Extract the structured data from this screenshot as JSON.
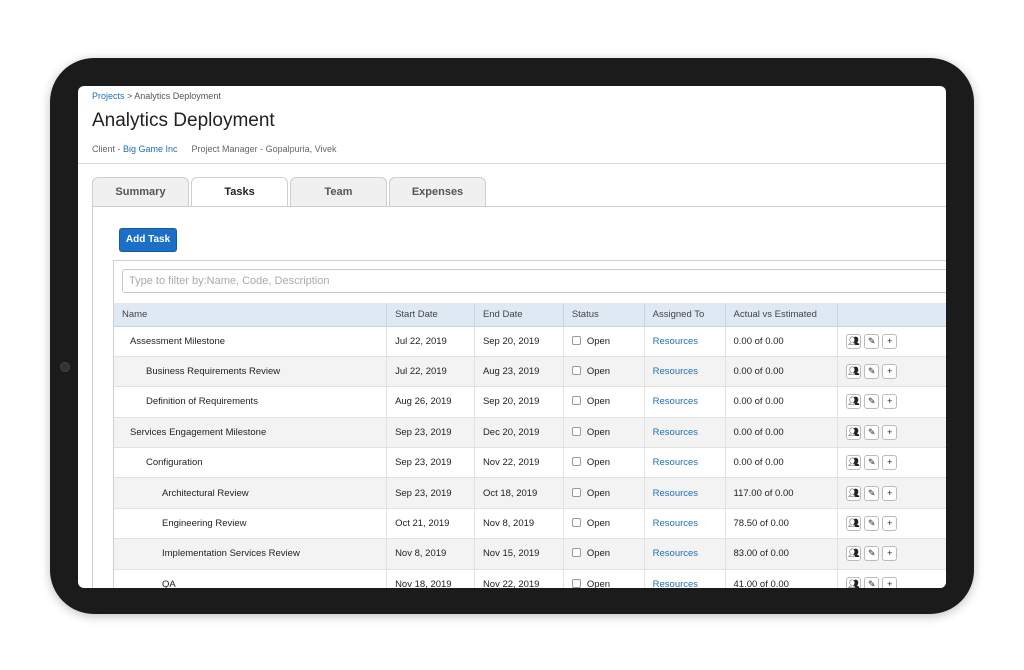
{
  "breadcrumb": {
    "root": "Projects",
    "separator": " > ",
    "current": "Analytics Deployment"
  },
  "page": {
    "title": "Analytics Deployment"
  },
  "meta": {
    "client_label": "Client - ",
    "client_name": "Big Game Inc",
    "pm_label": "Project Manager - ",
    "pm_name": "Gopalpuria, Vivek"
  },
  "tabs": [
    {
      "label": "Summary",
      "active": false
    },
    {
      "label": "Tasks",
      "active": true
    },
    {
      "label": "Team",
      "active": false
    },
    {
      "label": "Expenses",
      "active": false
    }
  ],
  "toolbar": {
    "add_task_label": "Add Task"
  },
  "filter": {
    "placeholder": "Type to filter by:Name, Code, Description",
    "value": ""
  },
  "table": {
    "columns": [
      "Name",
      "Start Date",
      "End Date",
      "Status",
      "Assigned To",
      "Actual vs Estimated",
      ""
    ],
    "rows": [
      {
        "name": "Assessment Milestone",
        "start": "Jul 22, 2019",
        "end": "Sep 20, 2019",
        "status": "Open",
        "assigned": "Resources",
        "actual": "0.00 of 0.00"
      },
      {
        "name": "Business Requirements Review",
        "start": "Jul 22, 2019",
        "end": "Aug 23, 2019",
        "status": "Open",
        "assigned": "Resources",
        "actual": "0.00 of 0.00"
      },
      {
        "name": "Definition of Requirements",
        "start": "Aug 26, 2019",
        "end": "Sep 20, 2019",
        "status": "Open",
        "assigned": "Resources",
        "actual": "0.00 of 0.00"
      },
      {
        "name": "Services Engagement Milestone",
        "start": "Sep 23, 2019",
        "end": "Dec 20, 2019",
        "status": "Open",
        "assigned": "Resources",
        "actual": "0.00 of 0.00"
      },
      {
        "name": "Configuration",
        "start": "Sep 23, 2019",
        "end": "Nov 22, 2019",
        "status": "Open",
        "assigned": "Resources",
        "actual": "0.00 of 0.00"
      },
      {
        "name": "Architectural Review",
        "start": "Sep 23, 2019",
        "end": "Oct 18, 2019",
        "status": "Open",
        "assigned": "Resources",
        "actual": "117.00 of 0.00"
      },
      {
        "name": "Engineering Review",
        "start": "Oct 21, 2019",
        "end": "Nov 8, 2019",
        "status": "Open",
        "assigned": "Resources",
        "actual": "78.50 of 0.00"
      },
      {
        "name": "Implementation Services Review",
        "start": "Nov 8, 2019",
        "end": "Nov 15, 2019",
        "status": "Open",
        "assigned": "Resources",
        "actual": "83.00 of 0.00"
      },
      {
        "name": "QA",
        "start": "Nov 18, 2019",
        "end": "Nov 22, 2019",
        "status": "Open",
        "assigned": "Resources",
        "actual": "41.00 of 0.00"
      }
    ]
  },
  "row_actions": {
    "team_icon": "people-icon",
    "edit_icon": "pencil-icon",
    "add_icon": "plus-icon"
  },
  "colors": {
    "accent": "#1c6fc6",
    "link": "#1f6fb5",
    "header_bg": "#dfe9f3",
    "device_bezel": "#1b1b1b"
  }
}
